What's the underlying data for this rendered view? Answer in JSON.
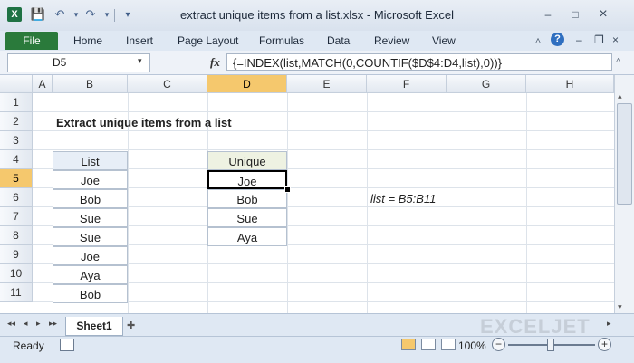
{
  "window": {
    "title": "extract unique items from a list.xlsx - Microsoft Excel",
    "app_icon": "X",
    "controls": {
      "minimize": "–",
      "maximize": "□",
      "close": "×"
    }
  },
  "quick_access": {
    "save": "💾",
    "undo": "↶",
    "redo": "↷",
    "dropdown": "▾",
    "customize": "▾"
  },
  "ribbon": {
    "file": "File",
    "tabs": [
      "Home",
      "Insert",
      "Page Layout",
      "Formulas",
      "Data",
      "Review",
      "View"
    ],
    "right_icons": {
      "minimize": "▵",
      "help": "?",
      "wb_minimize": "–",
      "wb_restore": "❐",
      "wb_close": "×"
    }
  },
  "formula_bar": {
    "name_box": "D5",
    "fx": "fx",
    "formula": "{=INDEX(list,MATCH(0,COUNTIF($D$4:D4,list),0))}"
  },
  "columns": [
    "A",
    "B",
    "C",
    "D",
    "E",
    "F",
    "G",
    "H"
  ],
  "rows": [
    "1",
    "2",
    "3",
    "4",
    "5",
    "6",
    "7",
    "8",
    "9",
    "10",
    "11"
  ],
  "active": {
    "column": "D",
    "row": "5"
  },
  "sheet": {
    "title": "Extract unique items from a list",
    "list_header": "List",
    "list": [
      "Joe",
      "Bob",
      "Sue",
      "Sue",
      "Joe",
      "Aya",
      "Bob"
    ],
    "unique_header": "Unique",
    "unique": [
      "Joe",
      "Bob",
      "Sue",
      "Aya"
    ],
    "note": "list = B5:B11"
  },
  "sheet_tabs": {
    "sheet1": "Sheet1",
    "nav": [
      "◂◂",
      "◂",
      "▸",
      "▸▸"
    ]
  },
  "watermark": "EXCELJET",
  "status_bar": {
    "status": "Ready",
    "zoom": "100%",
    "zoom_out": "−",
    "zoom_in": "+"
  },
  "colors": {
    "file_tab": "#2a7a3b",
    "selection_highlight": "#f5c86d",
    "list_header_fill": "#e7eef7",
    "unique_header_fill": "#eef2e2"
  }
}
